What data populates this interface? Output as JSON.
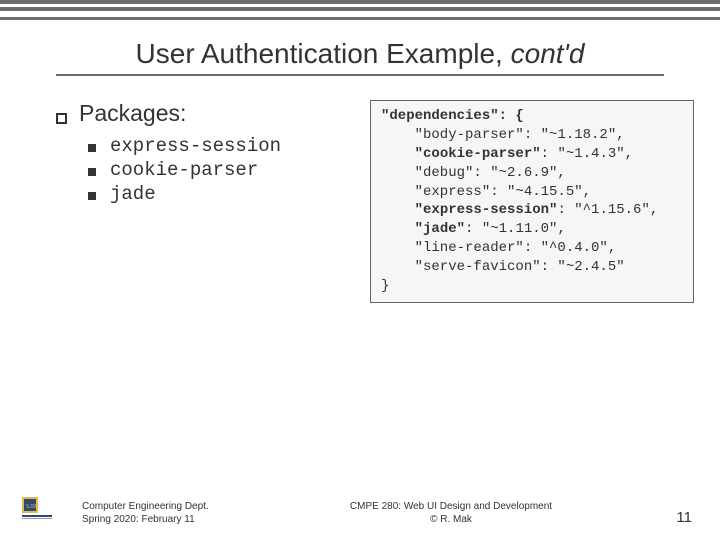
{
  "title": {
    "main": "User Authentication Example, ",
    "contd": "cont'd"
  },
  "packages": {
    "label": "Packages:",
    "items": [
      "express-session",
      "cookie-parser",
      "jade"
    ]
  },
  "dependencies": {
    "header": "\"dependencies\": {",
    "entries": [
      {
        "key": "body-parser",
        "version": "~1.18.2",
        "bold": false
      },
      {
        "key": "cookie-parser",
        "version": "~1.4.3",
        "bold": true
      },
      {
        "key": "debug",
        "version": "~2.6.9",
        "bold": false
      },
      {
        "key": "express",
        "version": "~4.15.5",
        "bold": false
      },
      {
        "key": "express-session",
        "version": "^1.15.6",
        "bold": true
      },
      {
        "key": "jade",
        "version": "~1.11.0",
        "bold": true
      },
      {
        "key": "line-reader",
        "version": "^0.4.0",
        "bold": false
      },
      {
        "key": "serve-favicon",
        "version": "~2.4.5",
        "bold": false
      }
    ],
    "close": "}"
  },
  "footer": {
    "dept_line1": "Computer Engineering Dept.",
    "dept_line2": "Spring 2020: February 11",
    "course_line1": "CMPE 280: Web UI Design and Development",
    "course_line2": "© R. Mak",
    "page": "11"
  }
}
